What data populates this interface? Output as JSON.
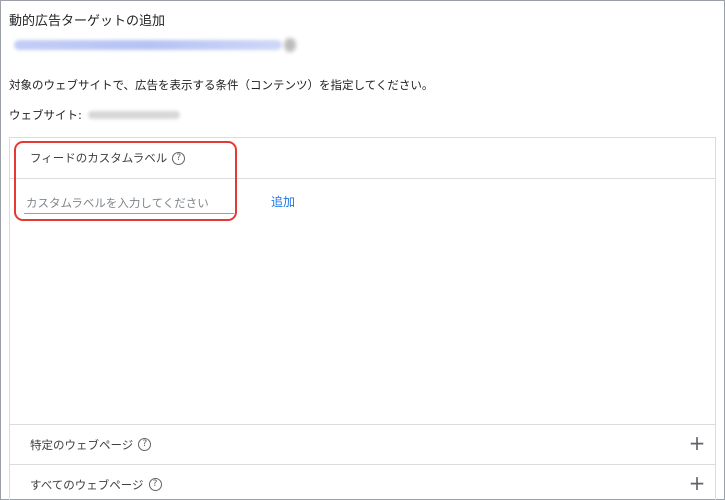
{
  "header": {
    "title": "動的広告ターゲットの追加",
    "description": "対象のウェブサイトで、広告を表示する条件（コンテンツ）を指定してください。",
    "website_label": "ウェブサイト:"
  },
  "feed_section": {
    "label": "フィードのカスタムラベル",
    "help_glyph": "?",
    "input_placeholder": "カスタムラベルを入力してください",
    "input_value": "",
    "add_label": "追加"
  },
  "sections": [
    {
      "label": "特定のウェブページ",
      "help_glyph": "?",
      "expand_glyph": "+"
    },
    {
      "label": "すべてのウェブページ",
      "help_glyph": "?",
      "expand_glyph": "+"
    }
  ],
  "colors": {
    "link": "#1a73e8",
    "highlight": "#e53935",
    "border": "#dadce0"
  }
}
